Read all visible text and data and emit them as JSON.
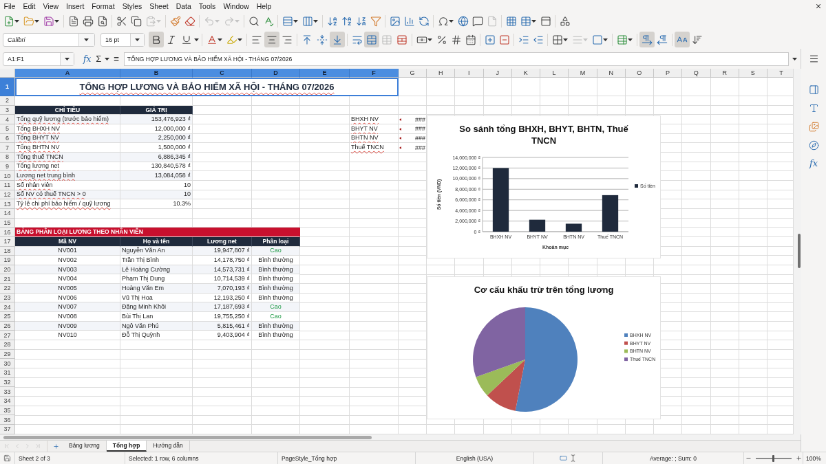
{
  "menu_bar": [
    "File",
    "Edit",
    "View",
    "Insert",
    "Format",
    "Styles",
    "Sheet",
    "Data",
    "Tools",
    "Window",
    "Help"
  ],
  "formatting_toolbar": {
    "font_name": "Calibri",
    "font_size": "16 pt",
    "style_buttons": [
      {
        "kind": "bold",
        "selected": true
      },
      {
        "kind": "italic",
        "selected": false
      },
      {
        "kind": "underline",
        "selected": false
      }
    ],
    "horizontal_align_buttons": [
      {
        "kind": "left",
        "selected": false
      },
      {
        "kind": "center",
        "selected": true
      },
      {
        "kind": "right",
        "selected": false
      }
    ],
    "vertical_align_buttons": [
      {
        "kind": "top",
        "selected": false
      },
      {
        "kind": "middle",
        "selected": false
      },
      {
        "kind": "bottom",
        "selected": true
      }
    ],
    "merge_buttons": [
      {
        "kind": "merge_center",
        "selected": true
      },
      {
        "kind": "merge",
        "selected": false
      },
      {
        "kind": "unmerge",
        "selected": false
      }
    ],
    "direction_buttons": [
      {
        "kind": "left_to_right",
        "selected": true
      },
      {
        "kind": "right_to_left",
        "selected": false
      }
    ],
    "orientation_buttons": [
      {
        "kind": "horizontal",
        "selected": true
      },
      {
        "kind": "vertical",
        "selected": false
      }
    ]
  },
  "formula_bar": {
    "name_box": "A1:F1",
    "function_wizard": "fx",
    "sum": "Σ",
    "formula": "=",
    "content": "TỔNG HỢP LƯƠNG VÀ BẢO HIỂM XÃ HỘI - THÁNG 07/2026"
  },
  "sheet": {
    "columns": [
      {
        "label": "A",
        "selected": true
      },
      {
        "label": "B",
        "selected": true
      },
      {
        "label": "C",
        "selected": true
      },
      {
        "label": "D",
        "selected": true
      },
      {
        "label": "E",
        "selected": true
      },
      {
        "label": "F",
        "selected": true
      },
      {
        "label": "G",
        "selected": false
      },
      {
        "label": "H",
        "selected": false
      },
      {
        "label": "I",
        "selected": false
      },
      {
        "label": "J",
        "selected": false
      },
      {
        "label": "K",
        "selected": false
      },
      {
        "label": "L",
        "selected": false
      },
      {
        "label": "M",
        "selected": false
      },
      {
        "label": "N",
        "selected": false
      },
      {
        "label": "O",
        "selected": false
      },
      {
        "label": "P",
        "selected": false
      },
      {
        "label": "Q",
        "selected": false
      },
      {
        "label": "R",
        "selected": false
      },
      {
        "label": "S",
        "selected": false
      },
      {
        "label": "T",
        "selected": false
      }
    ],
    "rows": [
      {
        "label": "1",
        "selected": true
      },
      {
        "label": "2",
        "selected": false
      },
      {
        "label": "3",
        "selected": false
      },
      {
        "label": "4",
        "selected": false
      },
      {
        "label": "5",
        "selected": false
      },
      {
        "label": "6",
        "selected": false
      },
      {
        "label": "7",
        "selected": false
      },
      {
        "label": "8",
        "selected": false
      },
      {
        "label": "9",
        "selected": false
      },
      {
        "label": "10",
        "selected": false
      },
      {
        "label": "11",
        "selected": false
      },
      {
        "label": "12",
        "selected": false
      },
      {
        "label": "13",
        "selected": false
      },
      {
        "label": "14",
        "selected": false
      },
      {
        "label": "15",
        "selected": false
      },
      {
        "label": "16",
        "selected": false
      },
      {
        "label": "17",
        "selected": false
      },
      {
        "label": "18",
        "selected": false
      },
      {
        "label": "19",
        "selected": false
      },
      {
        "label": "20",
        "selected": false
      },
      {
        "label": "21",
        "selected": false
      },
      {
        "label": "22",
        "selected": false
      },
      {
        "label": "23",
        "selected": false
      },
      {
        "label": "24",
        "selected": false
      },
      {
        "label": "25",
        "selected": false
      },
      {
        "label": "26",
        "selected": false
      },
      {
        "label": "27",
        "selected": false
      },
      {
        "label": "28",
        "selected": false
      },
      {
        "label": "29",
        "selected": false
      },
      {
        "label": "30",
        "selected": false
      },
      {
        "label": "31",
        "selected": false
      },
      {
        "label": "32",
        "selected": false
      },
      {
        "label": "33",
        "selected": false
      },
      {
        "label": "34",
        "selected": false
      },
      {
        "label": "35",
        "selected": false
      },
      {
        "label": "36",
        "selected": false
      },
      {
        "label": "37",
        "selected": false
      }
    ],
    "title": "TỔNG HỢP LƯƠNG VÀ BẢO HIỂM XÃ HỘI - THÁNG 07/2026",
    "summary": {
      "headers": [
        "CHỈ TIÊU",
        "GIÁ TRỊ"
      ],
      "rows": [
        {
          "label": "Tổng quỹ lương (trước bảo hiểm)",
          "value": "153,476,923 ₫"
        },
        {
          "label": "Tổng BHXH NV",
          "value": "12,000,000 ₫"
        },
        {
          "label": "Tổng BHYT NV",
          "value": "2,250,000 ₫"
        },
        {
          "label": "Tổng BHTN NV",
          "value": "1,500,000 ₫"
        },
        {
          "label": "Tổng thuế TNCN",
          "value": "6,886,345 ₫"
        },
        {
          "label": "Tổng lương net",
          "value": "130,840,578 ₫"
        },
        {
          "label": "Lương net trung bình",
          "value": "13,084,058 ₫"
        },
        {
          "label": "Số nhân viên",
          "value": "10"
        },
        {
          "label": "Số NV có thuế TNCN > 0",
          "value": "10"
        },
        {
          "label": "Tỷ lệ chi phí bảo hiểm / quỹ lương",
          "value": "10.3%"
        }
      ]
    },
    "chart_source": [
      {
        "label": "BHXH NV",
        "value": "###"
      },
      {
        "label": "BHYT NV",
        "value": "###"
      },
      {
        "label": "BHTN NV",
        "value": "###"
      },
      {
        "label": "Thuế TNCN",
        "value": "###"
      }
    ],
    "employee_table": {
      "title": "BẢNG PHÂN LOẠI LƯƠNG THEO NHÂN VIÊN",
      "headers": [
        "Mã NV",
        "Họ và tên",
        "Lương net",
        "Phân loại"
      ],
      "rows": [
        {
          "id": "NV001",
          "name": "Nguyễn Văn An",
          "net_salary": "19,947,807 ₫",
          "category": "Cao",
          "kind": "high"
        },
        {
          "id": "NV002",
          "name": "Trần Thị Bình",
          "net_salary": "14,178,750 ₫",
          "category": "Bình thường",
          "kind": "normal"
        },
        {
          "id": "NV003",
          "name": "Lê Hoàng Cường",
          "net_salary": "14,573,731 ₫",
          "category": "Bình thường",
          "kind": "normal"
        },
        {
          "id": "NV004",
          "name": "Phạm Thị Dung",
          "net_salary": "10,714,539 ₫",
          "category": "Bình thường",
          "kind": "normal"
        },
        {
          "id": "NV005",
          "name": "Hoàng Văn Em",
          "net_salary": "7,070,193 ₫",
          "category": "Bình thường",
          "kind": "normal"
        },
        {
          "id": "NV006",
          "name": "Vũ Thị Hoa",
          "net_salary": "12,193,250 ₫",
          "category": "Bình thường",
          "kind": "normal"
        },
        {
          "id": "NV007",
          "name": "Đặng Minh Khôi",
          "net_salary": "17,187,693 ₫",
          "category": "Cao",
          "kind": "high"
        },
        {
          "id": "NV008",
          "name": "Bùi Thị Lan",
          "net_salary": "19,755,250 ₫",
          "category": "Cao",
          "kind": "high"
        },
        {
          "id": "NV009",
          "name": "Ngô Văn Phú",
          "net_salary": "5,815,461 ₫",
          "category": "Bình thường",
          "kind": "normal"
        },
        {
          "id": "NV010",
          "name": "Đỗ Thị Quỳnh",
          "net_salary": "9,403,904 ₫",
          "category": "Bình thường",
          "kind": "normal"
        }
      ]
    }
  },
  "charts": [
    {
      "chart_data": {
        "type": "bar",
        "title": "So sánh tổng BHXH, BHYT, BHTN, Thuế TNCN",
        "xlabel": "Khoản mục",
        "ylabel": "Số tiền (VND)",
        "categories": [
          "BHXH NV",
          "BHYT NV",
          "BHTN NV",
          "Thuế TNCN"
        ],
        "series": [
          {
            "name": "Số tiền",
            "color": "#1f2a3c",
            "values": [
              12000000,
              2250000,
              1500000,
              6886345
            ]
          }
        ],
        "ylim": [
          0,
          14000000
        ],
        "yticks": [
          {
            "value": 0,
            "label": "0 ₫"
          },
          {
            "value": 2000000,
            "label": "2,000,000 ₫"
          },
          {
            "value": 4000000,
            "label": "4,000,000 ₫"
          },
          {
            "value": 6000000,
            "label": "6,000,000 ₫"
          },
          {
            "value": 8000000,
            "label": "8,000,000 ₫"
          },
          {
            "value": 10000000,
            "label": "10,000,000 ₫"
          },
          {
            "value": 12000000,
            "label": "12,000,000 ₫"
          },
          {
            "value": 14000000,
            "label": "14,000,000 ₫"
          }
        ],
        "grid": true,
        "legend": "right"
      }
    },
    {
      "chart_data": {
        "type": "pie",
        "title": "Cơ cấu khấu trừ trên tổng lương",
        "categories": [
          "BHXH NV",
          "BHYT NV",
          "BHTN NV",
          "Thuế TNCN"
        ],
        "values": [
          53.01,
          9.94,
          6.63,
          30.42
        ],
        "legend": "right"
      },
      "slices": [
        {
          "color": "#4f81bd"
        },
        {
          "color": "#c0504d"
        },
        {
          "color": "#9bbb59"
        },
        {
          "color": "#8064a2"
        }
      ]
    }
  ],
  "sidebar": {
    "functions": "fx"
  },
  "sheet_tabs": [
    {
      "label": "Bảng lương",
      "selected": false
    },
    {
      "label": "Tổng hợp",
      "selected": true
    },
    {
      "label": "Hướng dẫn",
      "selected": false
    }
  ],
  "status_bar": {
    "sheet": "Sheet 2 of 3",
    "selection": "Selected: 1 row, 6 columns",
    "page_style": "PageStyle_Tổng hợp",
    "language": "English (USA)",
    "summary": "Average: ; Sum: 0",
    "zoom": {
      "level": 0.5,
      "reading": "100%"
    }
  }
}
